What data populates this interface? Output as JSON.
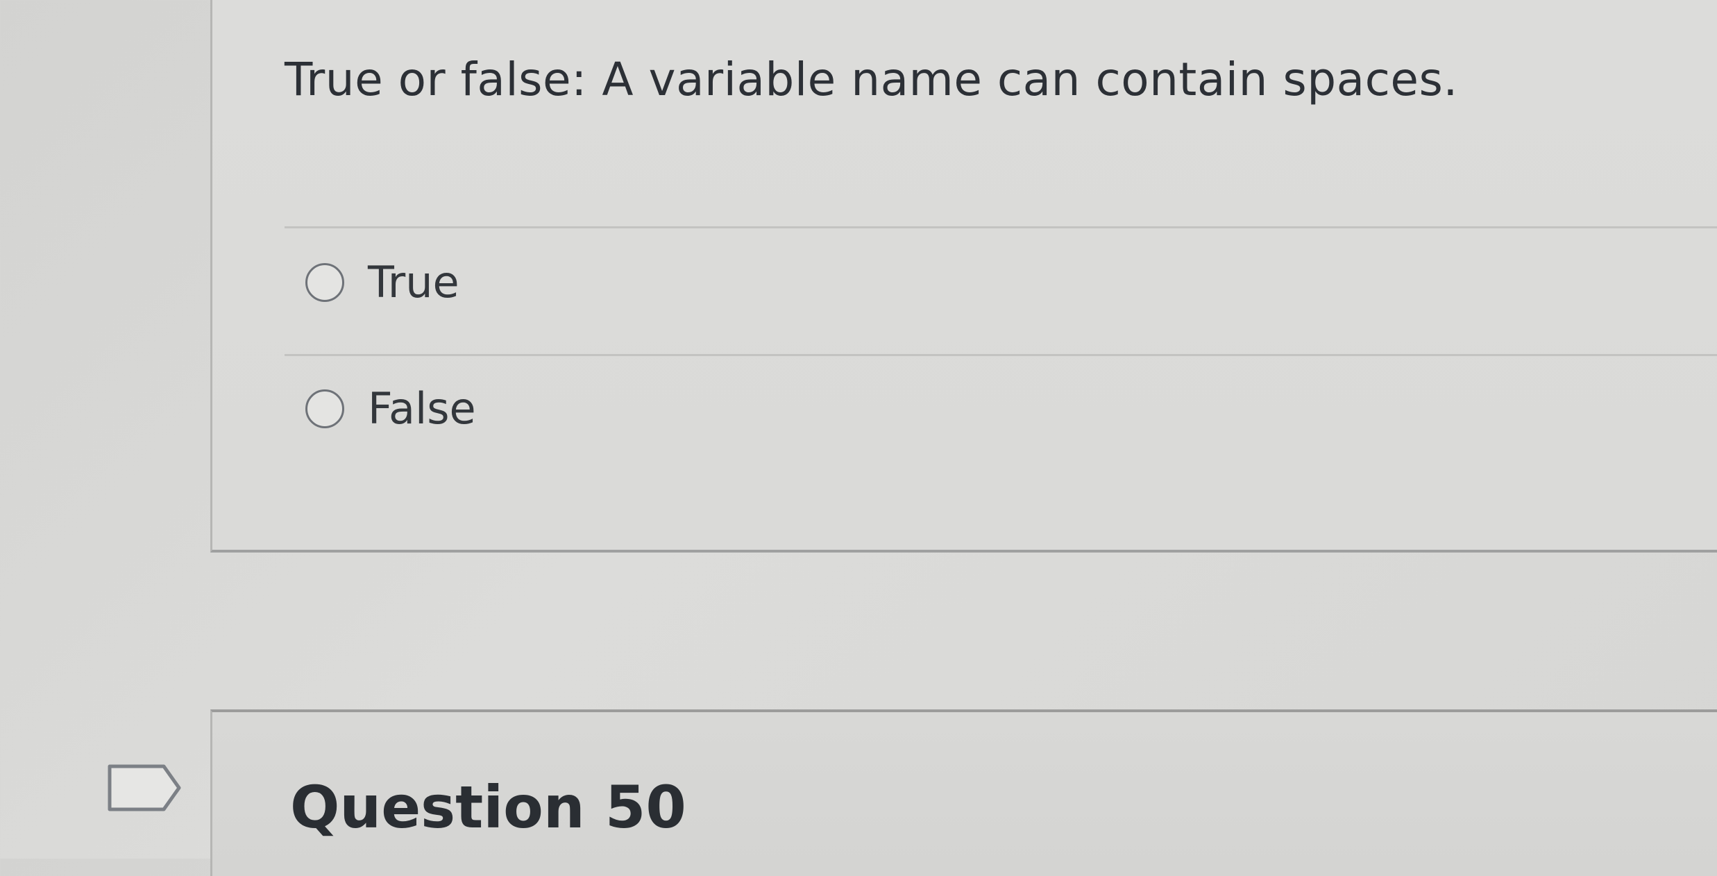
{
  "question": {
    "text": "True or false: A variable name can contain spaces.",
    "answers": [
      {
        "label": "True",
        "selected": false
      },
      {
        "label": "False",
        "selected": false
      }
    ]
  },
  "next_question": {
    "title": "Question 50",
    "flag_icon": "flag-outline-icon"
  },
  "colors": {
    "background": "#d8d8d6",
    "text": "#2c3036",
    "border": "#9fa0a0"
  }
}
